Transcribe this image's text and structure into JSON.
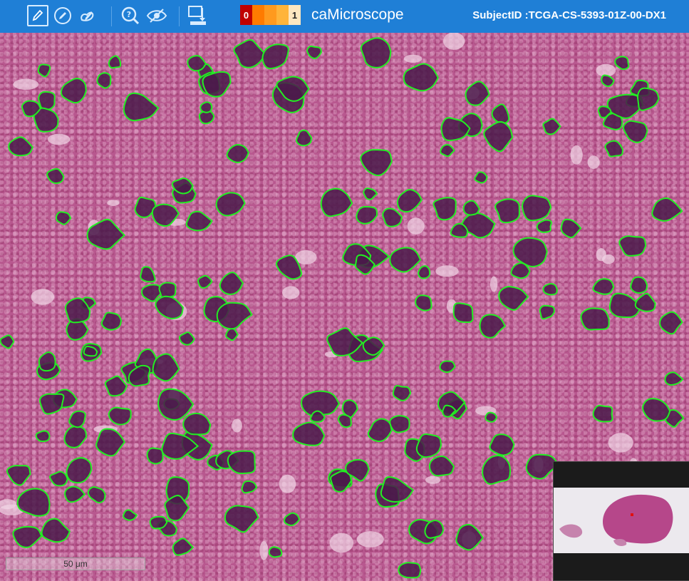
{
  "toolbar": {
    "tools": [
      {
        "name": "annotate-pencil-icon",
        "active": true
      },
      {
        "name": "draw-pencil-icon",
        "active": false
      },
      {
        "name": "freeform-tool-icon",
        "active": false
      },
      {
        "name": "help-search-icon",
        "active": false
      },
      {
        "name": "toggle-visibility-icon",
        "active": false
      },
      {
        "name": "export-download-icon",
        "active": false
      }
    ],
    "heatmap_legend": {
      "min_label": "0",
      "max_label": "1",
      "colors": [
        "#c00000",
        "#ff7b00",
        "#ffb43a",
        "#fde7c0"
      ]
    },
    "app_title": "caMicroscope",
    "subject_id": "SubjectID :TCGA-CS-5393-01Z-00-DX1"
  },
  "viewer": {
    "contour_color": "#22ee22",
    "scale_bar_label": "50 μm"
  }
}
